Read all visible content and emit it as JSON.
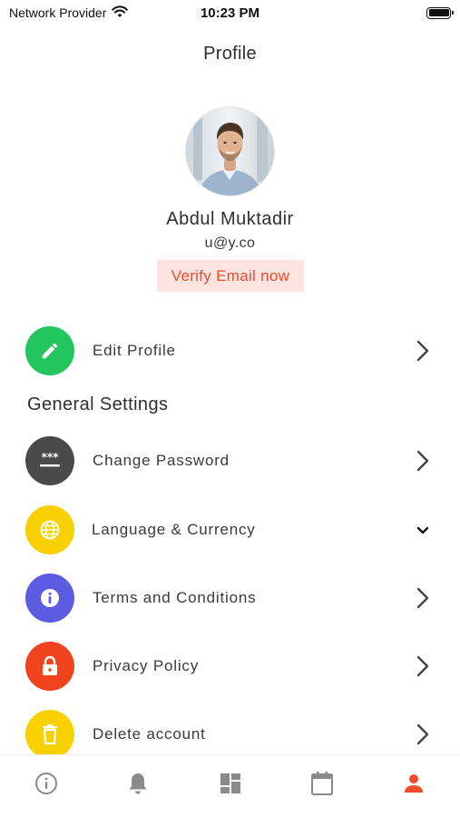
{
  "status_bar": {
    "carrier": "Network Provider",
    "time": "10:23 PM"
  },
  "header": {
    "title": "Profile"
  },
  "profile": {
    "name": "Abdul Muktadir",
    "email": "u@y.co",
    "verify_label": "Verify Email now"
  },
  "edit_profile": {
    "label": "Edit Profile",
    "icon": "pencil-icon",
    "color": "#22c55e"
  },
  "general_settings": {
    "title": "General Settings",
    "items": [
      {
        "label": "Change Password",
        "icon": "password-icon",
        "color": "#4a4a4a",
        "trailing": "chevron-right"
      },
      {
        "label": "Language & Currency",
        "icon": "globe-icon",
        "color": "#f9d000",
        "trailing": "chevron-down"
      },
      {
        "label": "Terms and Conditions",
        "icon": "info-icon",
        "color": "#5b5ce2",
        "trailing": "chevron-right"
      },
      {
        "label": "Privacy Policy",
        "icon": "lock-icon",
        "color": "#f0431e",
        "trailing": "chevron-right"
      },
      {
        "label": "Delete account",
        "icon": "trash-icon",
        "color": "#f9d000",
        "trailing": "chevron-right"
      }
    ]
  },
  "tab_bar": {
    "tabs": [
      {
        "icon": "info-outline-icon",
        "active": false
      },
      {
        "icon": "bell-icon",
        "active": false
      },
      {
        "icon": "dashboard-icon",
        "active": false
      },
      {
        "icon": "calendar-icon",
        "active": false
      },
      {
        "icon": "person-icon",
        "active": true
      }
    ],
    "active_color": "#ee4b2b",
    "inactive_color": "#8a8a8a"
  }
}
